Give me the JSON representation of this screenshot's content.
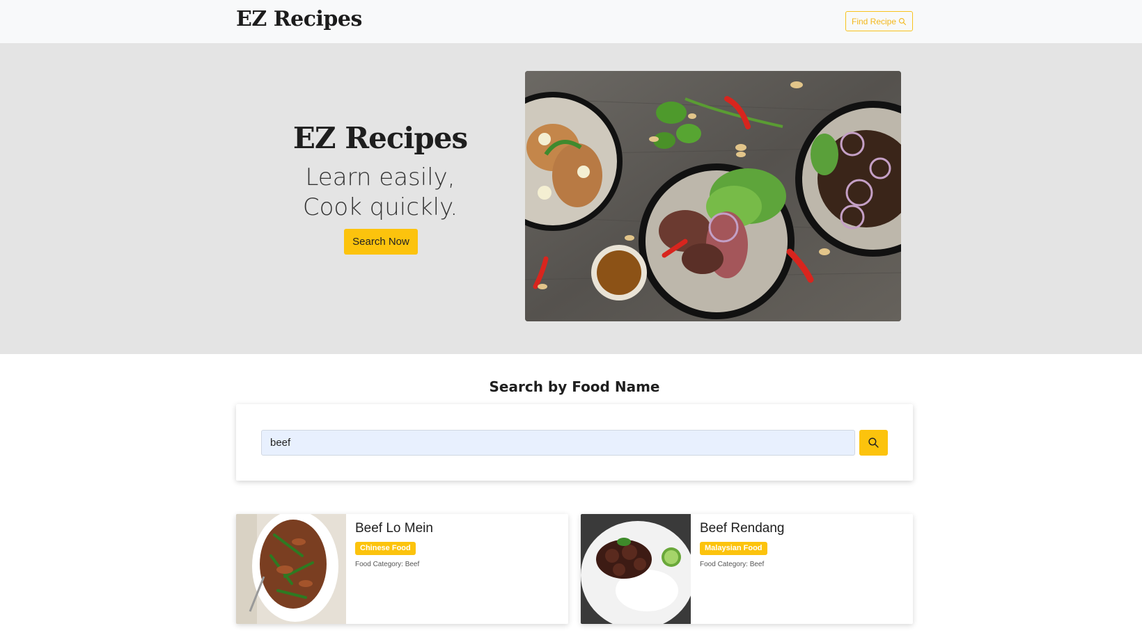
{
  "navbar": {
    "brand": "EZ Recipes",
    "find_button_label": "Find Recipe",
    "find_button_icon": "search-icon"
  },
  "hero": {
    "title": "EZ Recipes",
    "tagline_line1": "Learn easily,",
    "tagline_line2": "Cook quickly.",
    "button_label": "Search Now"
  },
  "search": {
    "heading": "Search by Food Name",
    "input_value": "beef",
    "button_icon": "search-icon"
  },
  "results": [
    {
      "name": "Beef Lo Mein",
      "badge": "Chinese Food",
      "category": "Food Category: Beef"
    },
    {
      "name": "Beef Rendang",
      "badge": "Malaysian Food",
      "category": "Food Category: Beef"
    }
  ],
  "colors": {
    "accent": "#fcc30d",
    "navbar_bg": "#f8f9fa",
    "hero_bg": "#e4e4e4"
  }
}
